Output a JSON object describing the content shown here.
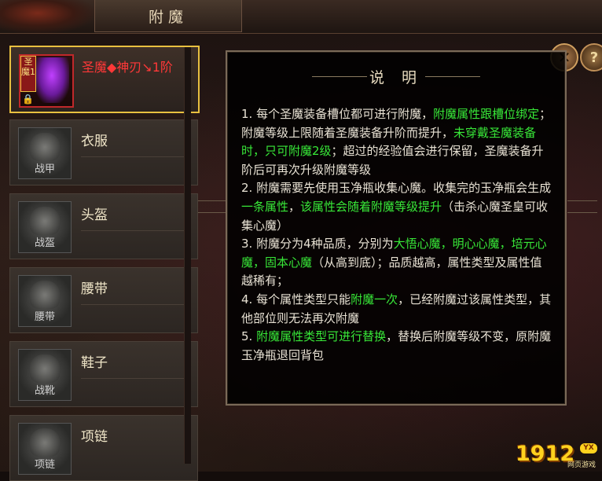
{
  "window": {
    "title": "附魔"
  },
  "sidebar": {
    "items": [
      {
        "label": "圣魔◆神刃↘1阶",
        "icon": "holy-demon-weapon-icon",
        "tag": "圣魔1",
        "selected": true
      },
      {
        "label": "衣服",
        "icon": "armor-icon",
        "icon_caption": "战甲",
        "selected": false
      },
      {
        "label": "头盔",
        "icon": "helmet-icon",
        "icon_caption": "战盔",
        "selected": false
      },
      {
        "label": "腰带",
        "icon": "belt-icon",
        "icon_caption": "腰带",
        "selected": false
      },
      {
        "label": "鞋子",
        "icon": "boots-icon",
        "icon_caption": "战靴",
        "selected": false
      },
      {
        "label": "项链",
        "icon": "necklace-icon",
        "icon_caption": "项链",
        "selected": false
      }
    ]
  },
  "buttons": {
    "close": "✕",
    "help": "?"
  },
  "panel": {
    "title": "说 明",
    "p1": [
      "1. 每个圣魔装备槽位都可进行附魔，",
      "附魔属性跟槽位绑定",
      "；附魔等级上限随着圣魔装备升阶而提升，",
      "未穿戴圣魔装备时，只可附魔2级",
      "；超过的经验值会进行保留，圣魔装备升阶后可再次升级附魔等级"
    ],
    "p2": [
      "2. 附魔需要先使用玉净瓶收集心魔。收集完的玉净瓶会生成",
      "一条属性",
      "，",
      "该属性会随着附魔等级提升",
      "（击杀心魔圣皇可收集心魔）"
    ],
    "p3": [
      "3. 附魔分为4种品质，分别为",
      "大悟心魔，明心心魔，培元心魔，固本心魔",
      "（从高到底）；品质越高，属性类型及属性值越稀有；"
    ],
    "p4": [
      "4. 每个属性类型只能",
      "附魔一次",
      "，已经附魔过该属性类型，其他部位则无法再次附魔"
    ],
    "p5": [
      "5. ",
      "附魔属性类型可进行替换",
      "，替换后附魔等级不变，原附魔玉净瓶退回背包"
    ]
  },
  "colors": {
    "highlight": "#38e838",
    "selected_border": "#e8c040",
    "selected_label": "#ff3838"
  },
  "watermark": {
    "number": "1912",
    "badge": "YX",
    "subtitle": "网页游戏"
  }
}
